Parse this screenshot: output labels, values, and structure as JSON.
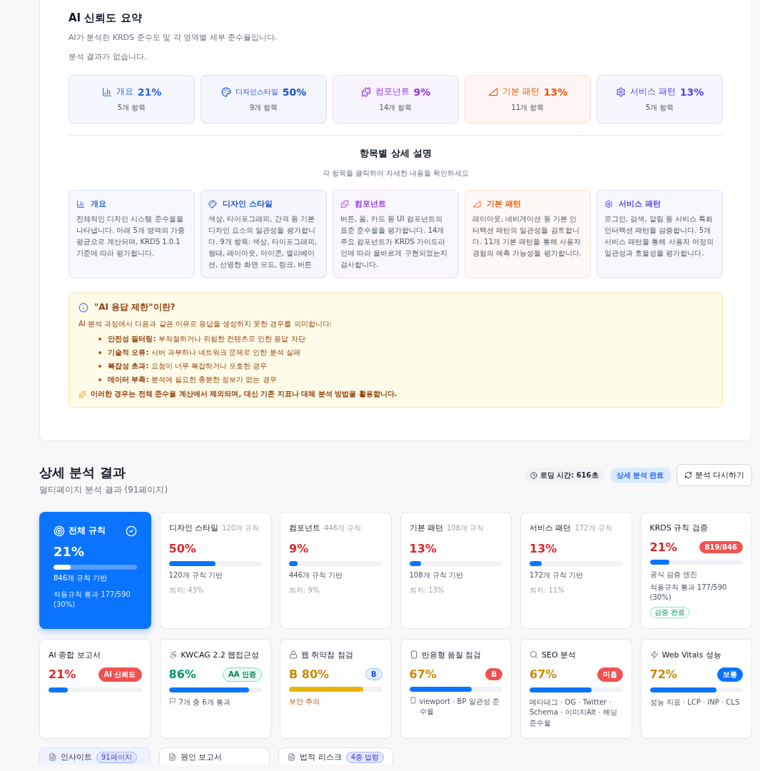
{
  "summary": {
    "title": "AI 신뢰도 요약",
    "subtitle": "AI가 분석한 KRDS 준수도 및 각 영역별 세부 준수율입니다.",
    "empty_note": "분석 결과가 없습니다.",
    "areas": [
      {
        "label": "개요",
        "percent": "21%",
        "count": "5개 항목",
        "color": "#2563eb"
      },
      {
        "label": "디자인스타일",
        "percent": "50%",
        "count": "9개 항목",
        "color": "#1d4ed8"
      },
      {
        "label": "컴포넌트",
        "percent": "9%",
        "count": "14개 항목",
        "color": "#9333ea"
      },
      {
        "label": "기본 패턴",
        "percent": "13%",
        "count": "11개 항목",
        "color": "#ea580c"
      },
      {
        "label": "서비스 패턴",
        "percent": "13%",
        "count": "5개 항목",
        "color": "#4f46e5"
      }
    ]
  },
  "details": {
    "title": "항목별 상세 설명",
    "subtitle": "각 항목을 클릭하여 자세한 내용을 확인하세요",
    "items": [
      {
        "title": "개요",
        "text": "전체적인 디자인 시스템 준수율을 나타냅니다. 아래 5개 영역의 가중 평균으로 계산되며, KRDS 1.0.1 기준에 따라 평가됩니다.",
        "color": "#2563eb"
      },
      {
        "title": "디자인 스타일",
        "text": "색상, 타이포그래피, 간격 등 기본 디자인 요소의 일관성을 평가합니다. 9개 항목: 색상, 타이포그래피, 형태, 레이아웃, 아이콘, 엘리베이션, 선명한 화면 모드, 링크, 버튼",
        "color": "#1d4ed8"
      },
      {
        "title": "컴포넌트",
        "text": "버튼, 폼, 카드 등 UI 컴포넌트의 표준 준수율을 평가합니다. 14개 주요 컴포넌트가 KRDS 가이드라인에 따라 올바르게 구현되었는지 검사합니다.",
        "color": "#9333ea"
      },
      {
        "title": "기본 패턴",
        "text": "레이아웃, 네비게이션 등 기본 인터랙션 패턴의 일관성을 검토합니다. 11개 기본 패턴을 통해 사용자 경험의 예측 가능성을 평가합니다.",
        "color": "#ea580c"
      },
      {
        "title": "서비스 패턴",
        "text": "로그인, 검색, 알림 등 서비스 특화 인터랙션 패턴을 검증합니다. 5개 서비스 패턴을 통해 사용자 여정의 일관성과 효율성을 평가합니다.",
        "color": "#4f46e5"
      }
    ]
  },
  "notice": {
    "title": "\"AI 응답 제한\"이란?",
    "intro": "AI 분석 과정에서 다음과 같은 이유로 응답을 생성하지 못한 경우를 의미합니다:",
    "reasons": [
      "**안전성 필터링:** 부적절하거나 위험한 컨텐츠로 인한 응답 차단",
      "**기술적 오류:** 서버 과부하나 네트워크 문제로 인한 분석 실패",
      "**복잡성 초과:** 요청이 너무 복잡하거나 모호한 경우",
      "**데이터 부족:** 분석에 필요한 충분한 정보가 없는 경우"
    ],
    "footer": "이러한 경우는 전체 준수율 계산에서 제외되며, 대신 기존 지표나 대체 분석 방법을 활용합니다."
  },
  "results": {
    "title": "상세 분석 결과",
    "subtitle": "멀티페이지 분석 결과 (91페이지)",
    "loading_time": "로딩 시간: 616초",
    "status": "상세 분석 완료",
    "rerun_button": "분석 다시하기",
    "cards": [
      {
        "kind": "overall",
        "title": "전체 규칙",
        "percent": "21%",
        "level": 0.21,
        "notes": [
          "846개 규칙 기반",
          "적용규칙 통과 177/590 (30%)"
        ]
      },
      {
        "kind": "rule",
        "title": "디자인 스타일",
        "sub": "120개 규칙",
        "percent": "50%",
        "level": 0.5,
        "notes": [
          "120개 규칙 기반",
          "최저: 43%"
        ]
      },
      {
        "kind": "rule",
        "title": "컴포넌트",
        "sub": "446개 규칙",
        "percent": "9%",
        "level": 0.09,
        "notes": [
          "446개 규칙 기반",
          "최저: 9%"
        ]
      },
      {
        "kind": "rule",
        "title": "기본 패턴",
        "sub": "108개 규칙",
        "percent": "13%",
        "level": 0.13,
        "notes": [
          "108개 규칙 기반",
          "최저: 13%"
        ]
      },
      {
        "kind": "rule",
        "title": "서비스 패턴",
        "sub": "172개 규칙",
        "percent": "13%",
        "level": 0.13,
        "notes": [
          "172개 규칙 기반",
          "최저: 11%"
        ]
      },
      {
        "kind": "badge",
        "title": "KRDS 규칙 검증",
        "percent": "21%",
        "color": "#dc2626",
        "badge": {
          "text": "819/846",
          "kind": "solid-red"
        },
        "level": 0.21,
        "notes": [
          "공식 검증 엔진",
          "적용규칙 통과 177/590 (30%)"
        ],
        "tag": "검증 완료"
      },
      {
        "kind": "badge",
        "title": "AI 종합 보고서",
        "percent": "21%",
        "color": "#dc2626",
        "badge": {
          "text": "AI 신뢰도",
          "kind": "solid-red"
        },
        "level": 0.21
      },
      {
        "kind": "badge",
        "title": "KWCAG 2.2 웹접근성",
        "percent": "86%",
        "color": "#059669",
        "badge": {
          "text": "AA 인증",
          "kind": "outline-green"
        },
        "level": 0.86,
        "notes": [
          "7개 중 6개 통과"
        ]
      },
      {
        "kind": "warning",
        "title": "웹 취약점 점검",
        "percent": "B 80%",
        "color": "#ca8a04",
        "badge": {
          "text": "B",
          "kind": "outline-blue"
        },
        "level": 0.8,
        "notes": [
          "보안 주의"
        ]
      },
      {
        "kind": "badge",
        "title": "반응형 품질 점검",
        "percent": "67%",
        "color": "#ca8a04",
        "badge": {
          "text": "B",
          "kind": "solid-red"
        },
        "level": 0.67,
        "notes": [
          "viewport · BP 일관성 준수율"
        ]
      },
      {
        "kind": "badge",
        "title": "SEO 분석",
        "percent": "67%",
        "color": "#ca8a04",
        "badge": {
          "text": "미흡",
          "kind": "solid-red"
        },
        "level": 0.67,
        "notes": [
          "메타태그 · OG · Twitter · Schema · 이미지Alt · 헤딩 준수율"
        ]
      },
      {
        "kind": "badge",
        "title": "Web Vitals 성능",
        "percent": "72%",
        "color": "#ca8a04",
        "badge": {
          "text": "보통",
          "kind": "solid-blue"
        },
        "level": 0.72,
        "notes": [
          "성능 지표 · LCP · INP · CLS"
        ]
      }
    ],
    "more_cards": [
      {
        "title": "인사이트",
        "badge": "91페이지"
      },
      {
        "title": "원인 보고서"
      },
      {
        "title": "법적 리스크",
        "badge": "4종 법령"
      }
    ]
  }
}
